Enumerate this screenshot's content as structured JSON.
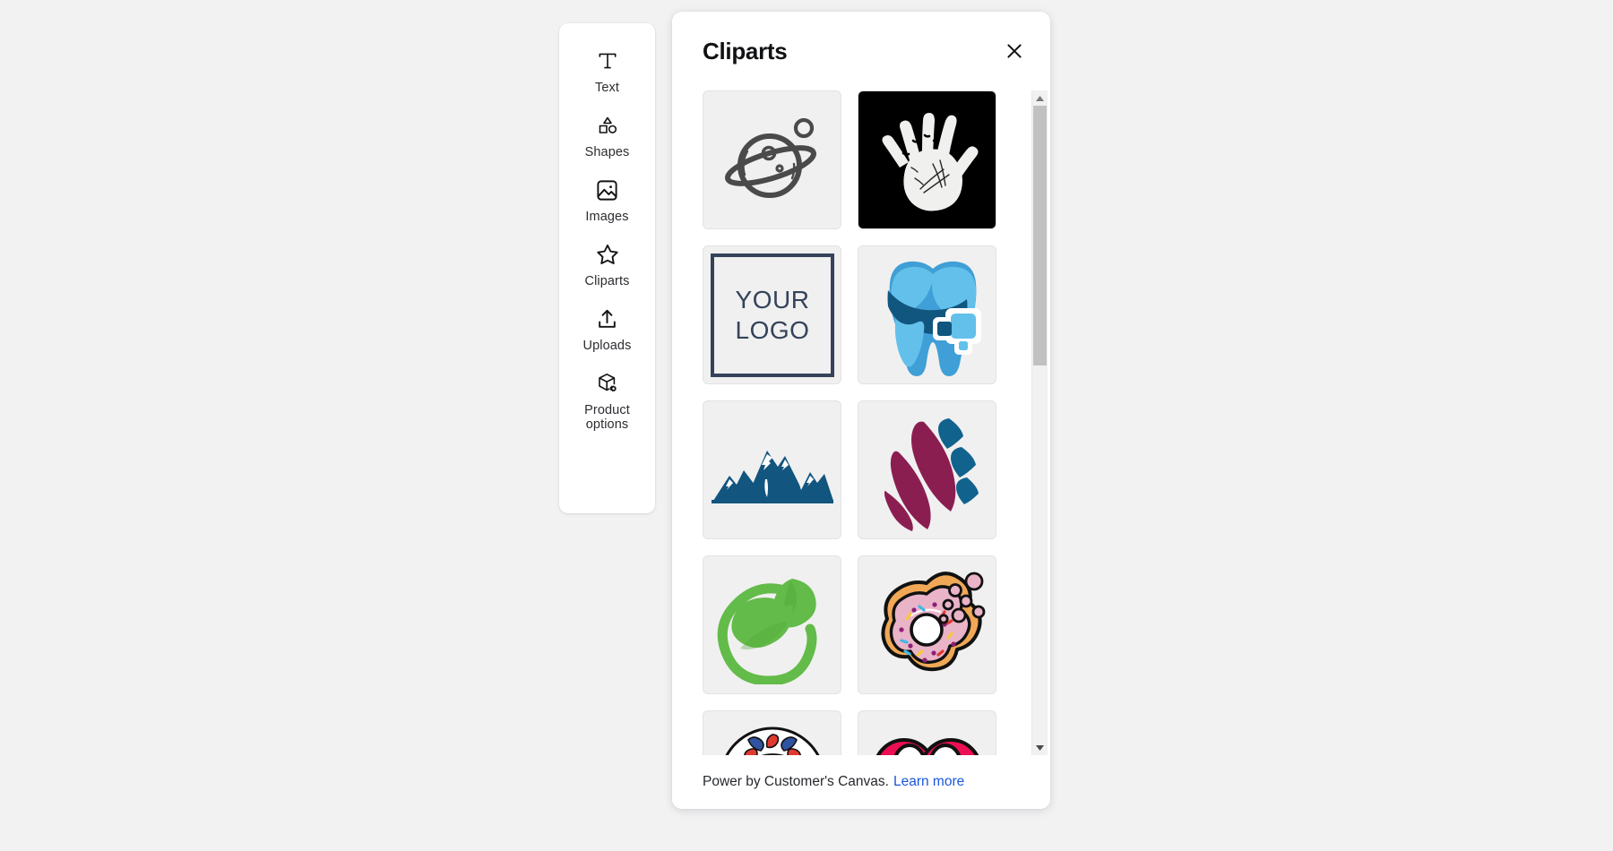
{
  "app": {
    "background_color": "#f2f2f3"
  },
  "sidebar": {
    "items": [
      {
        "label": "Text",
        "icon": "text-t-icon"
      },
      {
        "label": "Shapes",
        "icon": "shapes-icon"
      },
      {
        "label": "Images",
        "icon": "image-icon"
      },
      {
        "label": "Cliparts",
        "icon": "star-icon"
      },
      {
        "label": "Uploads",
        "icon": "upload-icon"
      },
      {
        "label": "Product options",
        "icon": "cube-gear-icon"
      }
    ]
  },
  "modal": {
    "title": "Cliparts",
    "close_icon": "close-x-icon",
    "footer": {
      "text": "Power by Customer's Canvas.",
      "link_label": "Learn more",
      "link_color": "#1a56db"
    },
    "scrollbar": {
      "up_icon": "caret-up-icon",
      "down_icon": "caret-down-icon",
      "thumb_position": "top",
      "thumb_size_percent": 41
    },
    "cliparts": [
      {
        "name": "planet-saturn",
        "bg": "#f0f0f0",
        "accent": "#4a4a4a"
      },
      {
        "name": "white-handprint",
        "bg": "#000000",
        "accent": "#f0f0ee"
      },
      {
        "name": "your-logo-placeholder",
        "bg": "#f0f0f0",
        "accent": "#34435a",
        "text_line1": "YOUR",
        "text_line2": "LOGO"
      },
      {
        "name": "blue-tooth-dental",
        "bg": "#f0f0f0",
        "accent": "#3f9fd6"
      },
      {
        "name": "blue-mountains",
        "bg": "#f0f0f0",
        "accent": "#12557f"
      },
      {
        "name": "maroon-blue-leaf",
        "bg": "#f0f0f0",
        "accent": "#8b1e51"
      },
      {
        "name": "green-leaf-circle",
        "bg": "#f0f0f0",
        "accent": "#63bb49"
      },
      {
        "name": "pink-donut-sprinkles",
        "bg": "#f0f0f0",
        "accent": "#e9b3c8"
      },
      {
        "name": "floral-rose-mandala",
        "bg": "#f0f0f0",
        "accent": "#e8b320"
      },
      {
        "name": "pink-cartoon-eyes",
        "bg": "#f0f0f0",
        "accent": "#ec0f53"
      }
    ]
  }
}
